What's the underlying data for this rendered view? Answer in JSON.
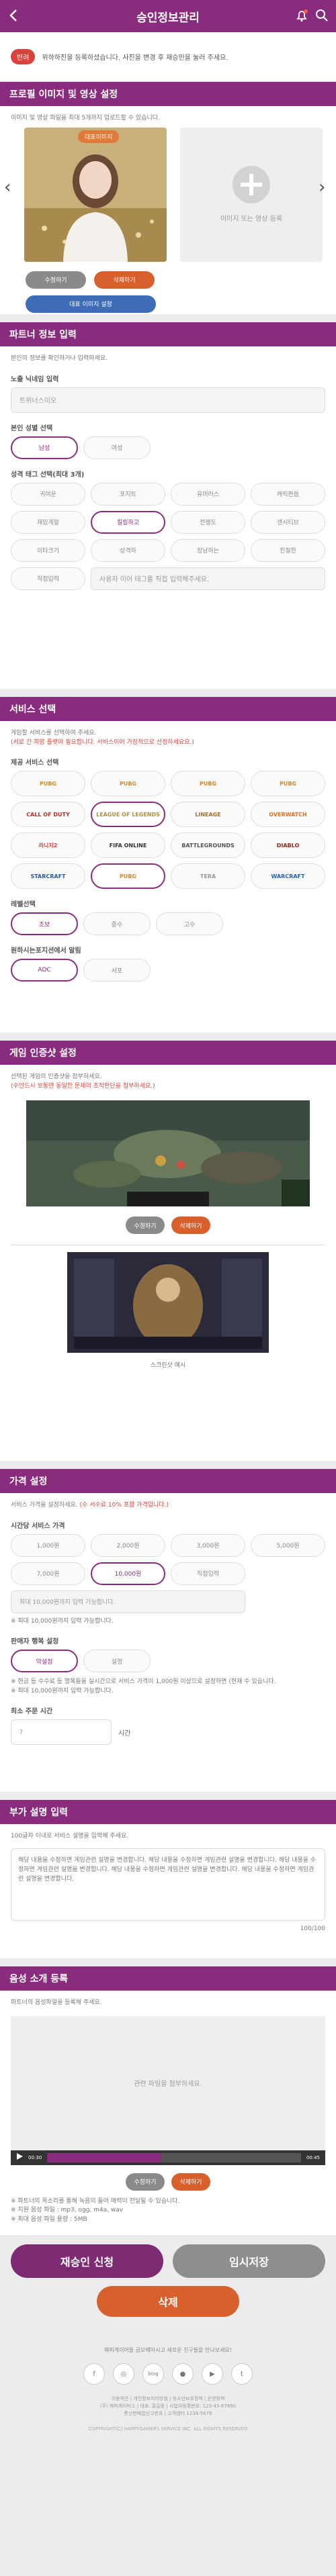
{
  "header": {
    "title": "승인정보관리"
  },
  "notice": {
    "badge": "반려",
    "text": "위하하진을 등록하셨습니다. 사진을 변경 후 재승인을 눌러 주세요."
  },
  "profile": {
    "title": "프로필 이미지 및 영상 설정",
    "desc": "이미지 및 영상 파일을 최대 5개까지 업로드할 수 있습니다.",
    "rep_tag": "대표이미지",
    "edit_btn": "수정하기",
    "delete_btn": "삭제하기",
    "set_rep_btn": "대표 이미지 설정",
    "add_label": "이미지 또는 영상 등록"
  },
  "partner": {
    "title": "파트너 정보 입력",
    "desc": "본인의 정보를 확인하거나 입력하세요.",
    "nickname_label": "노출 닉네임 입력",
    "nickname_placeholder": "트위너스이오",
    "gender_label": "본인 성별 선택",
    "genders": [
      "남성",
      "여성"
    ],
    "tags_label": "성격 태그 선택(최대 3개)",
    "tags": [
      "귀여운",
      "포지트",
      "유머러스",
      "캐릭판씀",
      "재밌게말",
      "킬링하고",
      "전쟁도",
      "센시티브",
      "이타크기",
      "상격하",
      "장남하는",
      "친절한",
      "직접입력"
    ],
    "tag_placeholder": "사용자 이어 태그를 직접 입력해주세요."
  },
  "service": {
    "title": "서비스 선택",
    "desc": "게임할 서비스를 선택하여 주세요.",
    "desc_red": "(서로 간 희망 플랫이 필요합니다. 서비스이어 가장적으로 선정하세요요.)",
    "games_label": "제공 서비스 선택",
    "games": [
      "PUBG",
      "PUBG",
      "PUBG",
      "PUBG",
      "CALL OF DUTY",
      "LEAGUE OF LEGENDS",
      "LINEAGE",
      "OVERWATCH",
      "리니지2",
      "FIFA ONLINE",
      "BATTLEGROUNDS",
      "DIABLO",
      "STARCRAFT",
      "PUBG",
      "TERA",
      "WARCRAFT"
    ],
    "tier_label": "레벨선택",
    "tiers": [
      "초보",
      "중수",
      "고수"
    ],
    "position_label": "원하시는포지션에서 알림",
    "positions": [
      "ADC",
      "서포"
    ]
  },
  "certify": {
    "title": "게임 인증샷 설정",
    "desc": "선택된 게임의 인증샷을 첨부하세요.",
    "desc_red": "(수인드시 보통만 동일한 문제의 조작판단을 첨부하세요.)",
    "edit_btn": "수정하기",
    "delete_btn": "삭제하기",
    "example_label": "스크린샷 예시"
  },
  "price": {
    "title": "가격 설정",
    "desc": "서비스 가격을 설정하세요.",
    "desc_red": "(수 서수료 10% 포함 가격입니다.)",
    "time_label": "시간당 서비스 가격",
    "prices": [
      "1,000원",
      "2,000원",
      "3,000원",
      "5,000원",
      "7,000원",
      "10,000원"
    ],
    "custom_label": "직접입력",
    "custom_placeholder": "최대 10,000원까지 입력 가능합니다.",
    "note": "※ 최대 10,000원까지 입력 가능합니다.",
    "method_label": "판매자 행복 설정",
    "methods": [
      "악설정",
      "설정"
    ],
    "method_note": "※ 현금 등 수수료 등 행복들을 실시간으로 서비스 가격이 1,000원 이상으로 설정하면 (현재 수 있습니다.",
    "method_note2": "※ 최대 10,000원까지 입력 가능합니다.",
    "min_label": "최소 주문 시간",
    "min_value": "?",
    "min_unit": "시간"
  },
  "extra": {
    "title": "부가 설명 입력",
    "desc": "100글자 이내로 서비스 설명을 입력해 주세요.",
    "text": "해당 내용을 수정하면 게임관련 설명을 변경합니다. 해당 내용을 수정하면 게임관련 설명을 변경합니다. 해당 내용을 수정하면 게임관련 설명을 변경합니다. 해당 내용을 수정하면 게임관련 설명을 변경합니다. 해당 내용을 수정하면 게임관련 설명을 변경합니다.",
    "counter": "100/100"
  },
  "voice": {
    "title": "음성 소개 등록",
    "desc": "파트너의 음성파일을 등록해 주세요.",
    "drop": "관련 파일을 첨부하세요.",
    "time_start": "00:30",
    "time_end": "00:45",
    "progress": 0.45,
    "edit_btn": "수정하기",
    "delete_btn": "삭제하기",
    "notes": [
      "※ 파트너의 목소리를 통해 녹음의 들어 매력이 전달될 수 있습니다.",
      "※ 지원 음성 파일 : mp3, ogg, m4a, wav",
      "※ 최대 음성 파일 용량 : 5MB"
    ]
  },
  "actions": {
    "reapprove": "재승인 신청",
    "save": "임시저장",
    "delete": "삭제"
  },
  "footer": {
    "text": "해피게이머들 곰모예마시고 새로운 친구들을 만나보세요!",
    "social": [
      "f",
      "◎",
      "blog",
      "●",
      "▶",
      "t"
    ],
    "info1": "이용약관 | 개인정보처리방침 | 청소년보호정책 | 운영정책",
    "info2": "(주) 해피게이머스 | 대표: 홍길동 | 사업자등록번호: 123-45-67890",
    "info3": "통신판매업신고번호 | 고객센터 1234-5678",
    "copy": "COPYRIGHT(C) HAPPYGAMERS SERVICE INC. ALL RIGHTS RESERVED"
  }
}
